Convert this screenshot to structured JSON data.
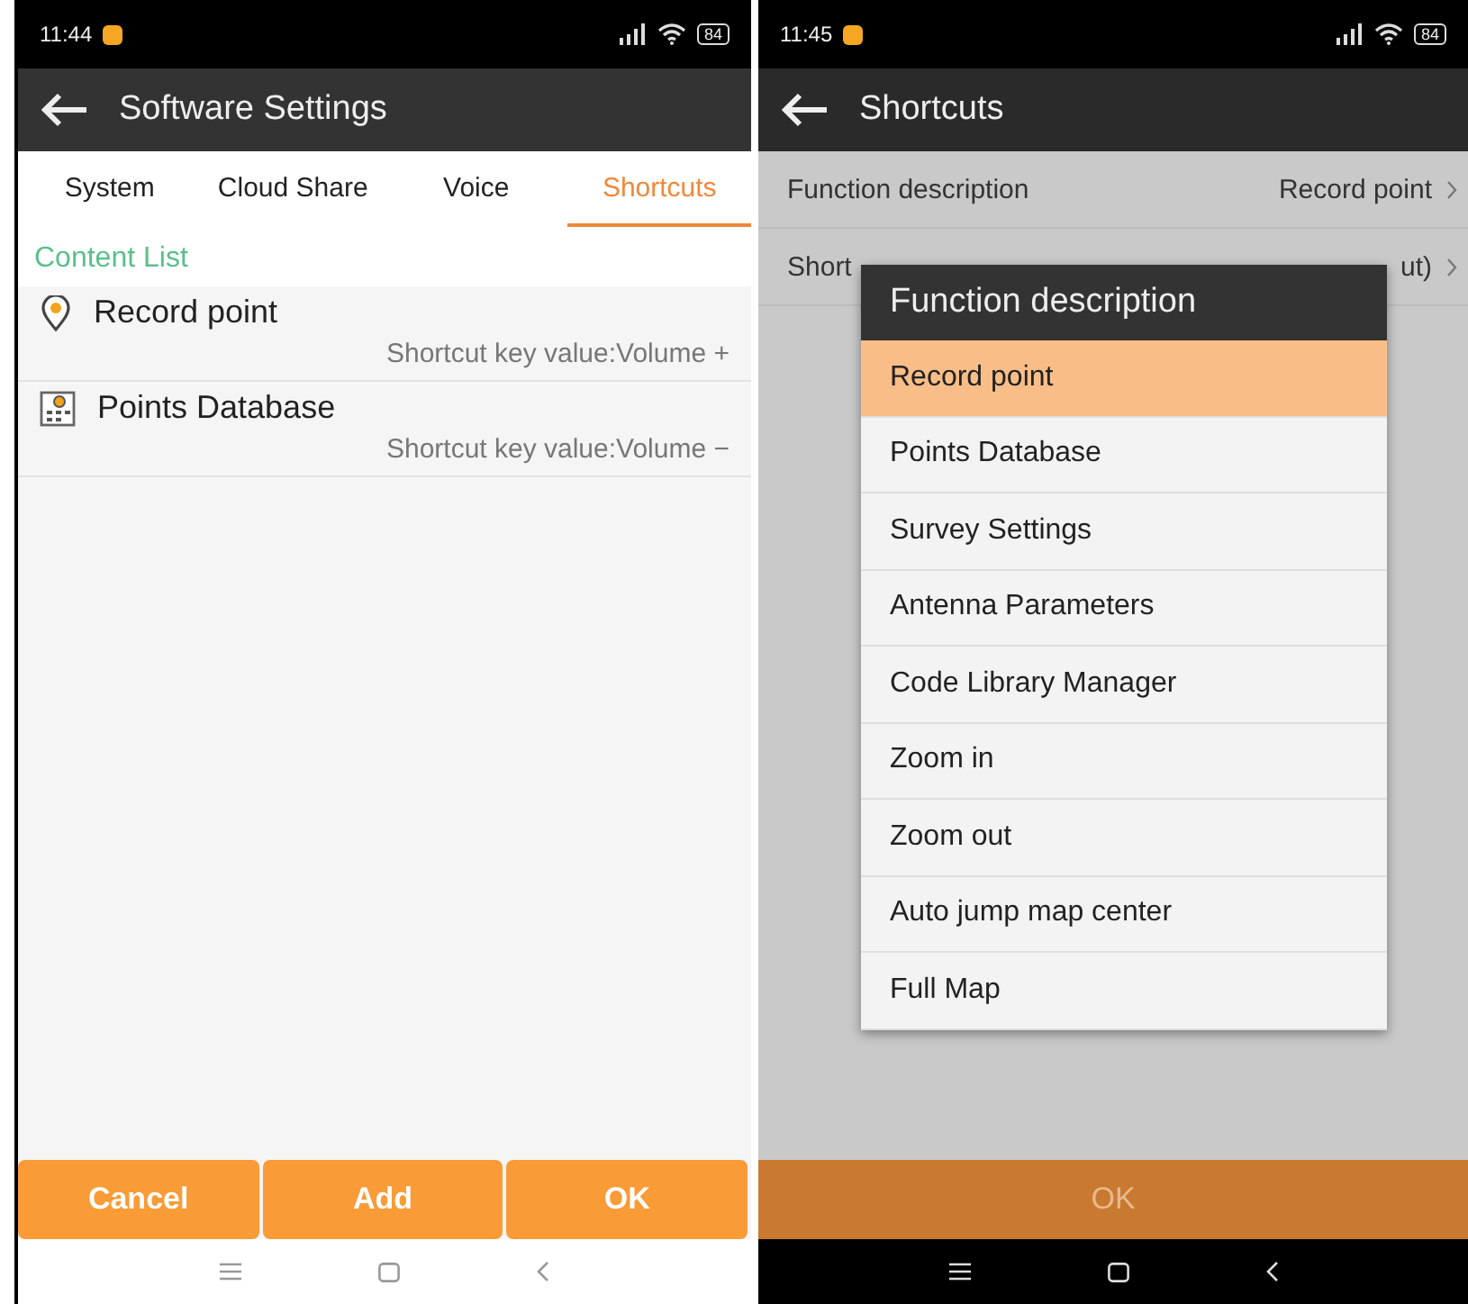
{
  "left": {
    "status_bar": {
      "time": "11:44",
      "battery": "84"
    },
    "app_bar": {
      "title": "Software Settings"
    },
    "tabs": [
      {
        "label": "System",
        "selected": false
      },
      {
        "label": "Cloud Share",
        "selected": false
      },
      {
        "label": "Voice",
        "selected": false
      },
      {
        "label": "Shortcuts",
        "selected": true
      }
    ],
    "section_header": "Content List",
    "items": [
      {
        "kind": "pin",
        "title": "Record point",
        "shortcut": "Shortcut key value:Volume +"
      },
      {
        "kind": "database",
        "title": "Points Database",
        "shortcut": "Shortcut key value:Volume −"
      }
    ],
    "buttons": [
      "Cancel",
      "Add",
      "OK"
    ]
  },
  "right": {
    "status_bar": {
      "time": "11:45",
      "battery": "84"
    },
    "app_bar": {
      "title": "Shortcuts"
    },
    "rows": [
      {
        "label": "Function description",
        "value": "Record point"
      },
      {
        "label": "Short",
        "value": "ut)"
      }
    ],
    "dialog": {
      "title": "Function description",
      "options": [
        {
          "label": "Record point",
          "selected": true
        },
        {
          "label": "Points Database",
          "selected": false
        },
        {
          "label": "Survey Settings",
          "selected": false
        },
        {
          "label": "Antenna Parameters",
          "selected": false
        },
        {
          "label": "Code Library Manager",
          "selected": false
        },
        {
          "label": "Zoom in",
          "selected": false
        },
        {
          "label": "Zoom out",
          "selected": false
        },
        {
          "label": "Auto jump map center",
          "selected": false
        },
        {
          "label": "Full Map",
          "selected": false
        }
      ]
    },
    "button": {
      "label": "OK",
      "disabled": true
    }
  }
}
